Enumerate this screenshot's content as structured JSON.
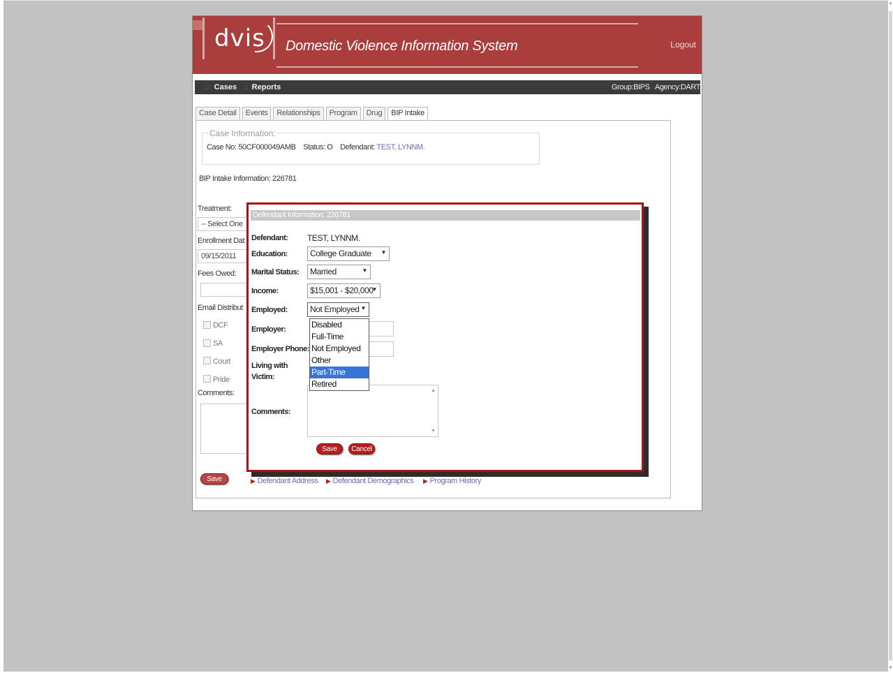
{
  "app": {
    "logo_text": "dvis",
    "title": "Domestic Violence Information System",
    "logout": "Logout"
  },
  "menu": {
    "items": [
      "Cases",
      "Reports"
    ],
    "group_agency": "Group:BIPS   Agency:DART"
  },
  "tabs": [
    "Case Detail",
    "Events",
    "Relationships",
    "Program",
    "Drug",
    "BIP Intake"
  ],
  "active_tab": "BIP Intake",
  "case_info": {
    "legend": "Case Information:",
    "case_no_label": "Case No:",
    "case_no": "50CF000049AMB",
    "status_label": "Status:",
    "status": "O",
    "defendant_label": "Defendant:",
    "defendant": "TEST, LYNNM."
  },
  "bip": {
    "heading": "BIP Intake Information: 226781",
    "treatment_label": "Treatment:",
    "treatment_value": "-- Select One",
    "enrollment_label": "Enrollment Dat",
    "enrollment_value": "09/15/2011",
    "fees_label": "Fees Owed:",
    "email_label": "Email Distribut",
    "checkboxes": [
      "DCF",
      "SA",
      "Court",
      "Pride"
    ],
    "comments_label": "Comments:",
    "save": "Save",
    "links": [
      "Defendant Address",
      "Defendant Demographics",
      "Program History"
    ]
  },
  "dialog": {
    "title": "Defendant Information: 226781",
    "defendant_label": "Defendant:",
    "defendant_value": "TEST, LYNNM.",
    "education_label": "Education:",
    "education_value": "College Graduate",
    "marital_label": "Marital Status:",
    "marital_value": "Married",
    "income_label": "Income:",
    "income_value": "$15,001 - $20,000",
    "employed_label": "Employed:",
    "employed_value": "Not Employed",
    "employer_label": "Employer:",
    "employer_phone_label": "Employer Phone:",
    "living_label_1": "Living with",
    "living_label_2": "Victim:",
    "comments_label": "Comments:",
    "employed_options": [
      "Disabled",
      "Full-Time",
      "Not Employed",
      "Other",
      "Part-Time",
      "Retired"
    ],
    "highlighted_option": "Part-Time",
    "save": "Save",
    "cancel": "Cancel"
  },
  "colors": {
    "brand_red": "#a93e3c",
    "dialog_border": "#a81414",
    "link": "#6b6bb8",
    "highlight": "#3875d7"
  }
}
